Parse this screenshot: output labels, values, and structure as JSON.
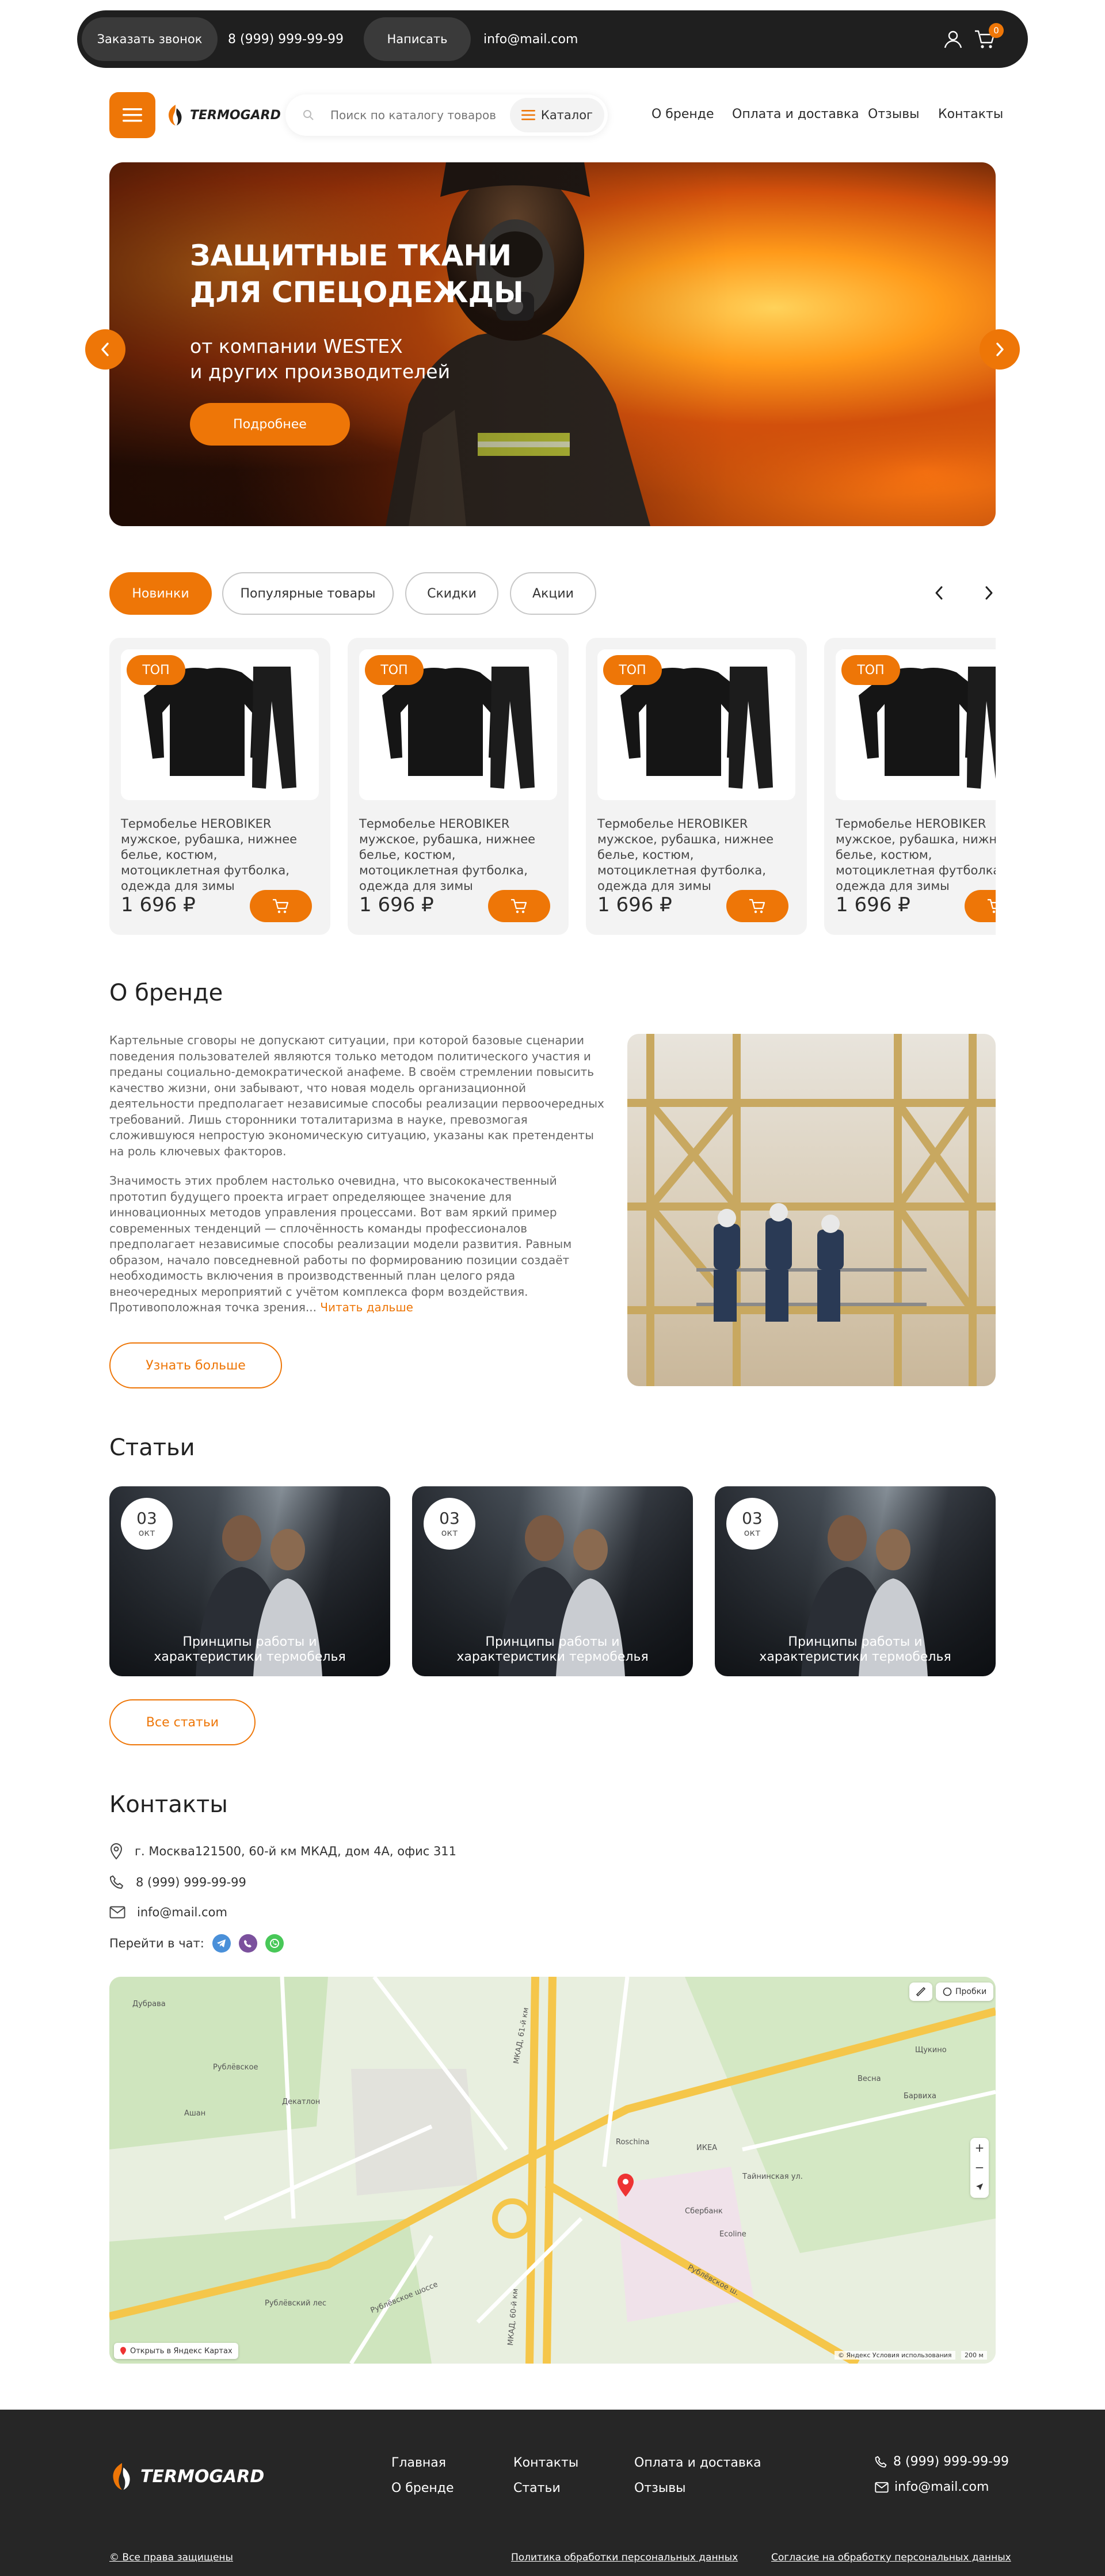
{
  "topbar": {
    "call_button": "Заказать звонок",
    "phone": "8 (999) 999-99-99",
    "write_button": "Написать",
    "email": "info@mail.com",
    "cart_count": "0"
  },
  "header": {
    "logo_text": "TERMOGARD",
    "search_placeholder": "Поиск по каталогу товаров",
    "catalog_label": "Каталог",
    "nav": [
      "О бренде",
      "Оплата и доставка",
      "Отзывы",
      "Контакты"
    ]
  },
  "hero": {
    "title_line1": "ЗАЩИТНЫЕ ТКАНИ",
    "title_line2": "ДЛЯ СПЕЦОДЕЖДЫ",
    "subtitle_line1": "от компании WESTEX",
    "subtitle_line2": "и других производителей",
    "button": "Подробнее"
  },
  "tabs": [
    "Новинки",
    "Популярные товары",
    "Скидки",
    "Акции"
  ],
  "products": [
    {
      "badge": "ТОП",
      "name": "Термобелье HEROBIKER мужское, рубашка, нижнее белье, костюм, мотоциклетная футболка, одежда для зимы",
      "price": "1 696 ₽"
    },
    {
      "badge": "ТОП",
      "name": "Термобелье HEROBIKER мужское, рубашка, нижнее белье, костюм, мотоциклетная футболка, одежда для зимы",
      "price": "1 696 ₽"
    },
    {
      "badge": "ТОП",
      "name": "Термобелье HEROBIKER мужское, рубашка, нижнее белье, костюм, мотоциклетная футболка, одежда для зимы",
      "price": "1 696 ₽"
    },
    {
      "badge": "ТОП",
      "name": "Термобелье HEROBIKER мужское, рубашка, нижнее белье, костюм, мотоциклетная футболка, одежда для зимы",
      "price": "1 696 ₽"
    }
  ],
  "about": {
    "heading": "О бренде",
    "p1": "Картельные сговоры не допускают ситуации, при которой базовые сценарии поведения пользователей являются только методом политического участия и преданы социально-демократической анафеме. В своём стремлении повысить качество жизни, они забывают, что новая модель организационной деятельности предполагает независимые способы реализации первоочередных требований. Лишь сторонники тоталитаризма в науке, превозмогая сложившуюся непростую экономическую ситуацию, указаны как претенденты на роль ключевых факторов.",
    "p2": "Значимость этих проблем настолько очевидна, что высококачественный прототип будущего проекта играет определяющее значение для инновационных методов управления процессами. Вот вам яркий пример современных тенденций — сплочённость команды профессионалов предполагает независимые способы реализации модели развития. Равным образом, начало повседневной работы по формированию позиции создаёт необходимость включения в производственный план целого ряда внеочередных мероприятий с учётом комплекса форм воздействия. Противоположная точка зрения...",
    "read_more": "Читать дальше",
    "button": "Узнать больше"
  },
  "articles": {
    "heading": "Статьи",
    "items": [
      {
        "day": "03",
        "month": "окт",
        "title": "Принципы работы и характеристики термобелья"
      },
      {
        "day": "03",
        "month": "окт",
        "title": "Принципы работы и характеристики термобелья"
      },
      {
        "day": "03",
        "month": "окт",
        "title": "Принципы работы и характеристики термобелья"
      }
    ],
    "button": "Все статьи"
  },
  "contacts": {
    "heading": "Контакты",
    "address": "г. Москва121500, 60-й км МКАД, дом 4А, офис 311",
    "phone": "8 (999) 999-99-99",
    "email": "info@mail.com",
    "chat_label": "Перейти в чат:",
    "map_open": "Открыть в Яндекс Картах",
    "map_traffic": "Пробки",
    "map_copyright": "© Яндекс  Условия использования",
    "map_scale": "200 м",
    "map_labels": [
      "МКАД, 61-й км",
      "МКАД, 60-й км",
      "Рублёвское шоссе",
      "Рублёвское ш.",
      "Тайнинская ул.",
      "Рублёвский лес",
      "Рублёвское",
      "Дубрава",
      "Ашан",
      "Roschina",
      "Барвиха",
      "Весна",
      "Сбербанк",
      "Ecoline",
      "Декатлон",
      "ИКЕА",
      "Щукинo"
    ]
  },
  "footer": {
    "logo_text": "TERMOGARD",
    "links": [
      "Главная",
      "Контакты",
      "Оплата и доставка",
      "О бренде",
      "Статьи",
      "Отзывы"
    ],
    "phone": "8 (999) 999-99-99",
    "email": "info@mail.com",
    "copyright": "© Все права защищены",
    "privacy": "Политика обработки персональных данных",
    "consent": "Согласие на обработку персональных данных"
  },
  "colors": {
    "accent": "#ee7607",
    "topbar": "#1f1f1f",
    "footer": "#262626",
    "card_bg": "#f3f3f3",
    "telegram": "#4a90d9",
    "viber": "#7b519d",
    "whatsapp": "#48c858"
  }
}
